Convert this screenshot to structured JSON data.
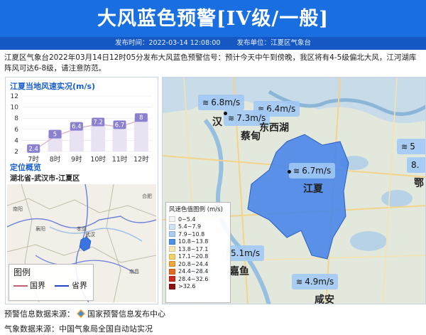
{
  "header": {
    "title": "大风蓝色预警[IV级/一般]",
    "publish_time": "发布时间：2022-03-14 12:08:00",
    "publisher": "发布单位：江夏区气象台"
  },
  "description": "江夏区气象台2022年03月14日12时05分发布大风蓝色预警信号：预计今天中午到傍晚，我区将有4-5级偏北大风，江河湖库阵风可达6-8级，请注意防范。",
  "wind_section": {
    "title": "江夏当地风速实况(m/s)"
  },
  "chart_data": {
    "type": "line",
    "title": "江夏当地风速实况(m/s)",
    "categories": [
      "7时",
      "8时",
      "9时",
      "10时",
      "11时",
      "12时"
    ],
    "values": [
      2.4,
      5,
      6.4,
      7.2,
      6.7,
      8
    ],
    "value_labels": [
      "2.4",
      "5",
      "6.4",
      "7.2",
      "6.7",
      "8"
    ],
    "ylim": [
      2,
      12
    ],
    "yticks": [
      "2",
      "4",
      "6",
      "8",
      "10",
      "12"
    ],
    "grid": true,
    "colors": {
      "line": "#d9b0c8",
      "bar": "#e9e2f3",
      "label": "#8a80d0"
    }
  },
  "location_section": {
    "title": "定位概览",
    "subtitle": "湖北省-武汉市-江夏区"
  },
  "mini_map": {
    "legend_title": "图例",
    "legend_items": [
      {
        "label": "国界",
        "color": "#c06070"
      },
      {
        "label": "省界",
        "color": "#2244cc"
      }
    ],
    "cities": [
      "南阳",
      "襄阳",
      "孝感",
      "武汉",
      "合肥",
      "南昌"
    ]
  },
  "main_map": {
    "legend_title": "风速色值图例 (m/s)",
    "legend_items": [
      {
        "label": "0~5.4",
        "color": "#f4f4f4"
      },
      {
        "label": "5.4~7.9",
        "color": "#cfe3f7"
      },
      {
        "label": "7.9~10.8",
        "color": "#a9cdf2"
      },
      {
        "label": "10.8~13.8",
        "color": "#4d8fe6"
      },
      {
        "label": "13.8~17.1",
        "color": "#f6e7b0"
      },
      {
        "label": "17.1~20.8",
        "color": "#f6d264"
      },
      {
        "label": "20.8~24.4",
        "color": "#f2a53a"
      },
      {
        "label": "24.4~28.4",
        "color": "#e9691f"
      },
      {
        "label": "28.4~32.6",
        "color": "#cc2a1a"
      },
      {
        "label": ">32.6",
        "color": "#8e1010"
      }
    ],
    "wind_readings": [
      {
        "value": "6.8m/s"
      },
      {
        "value": "6.4m/s"
      },
      {
        "value": "7.3m/s"
      },
      {
        "value": "6.7m/s"
      },
      {
        "value": "5.1m/s"
      },
      {
        "value": "4.9m/s"
      },
      {
        "value": "5"
      },
      {
        "value": "8."
      }
    ],
    "places": [
      "汉",
      "东西湖",
      "蔡甸",
      "江夏",
      "嘉鱼",
      "咸安",
      "鄂"
    ],
    "district_color": "#4a86e8"
  },
  "footer": {
    "warning_source": "预警信息数据来源：",
    "warning_source_name": "国家预警信息发布中心",
    "weather_source": "气象数据来源：中国气象局全国自动站实况"
  }
}
